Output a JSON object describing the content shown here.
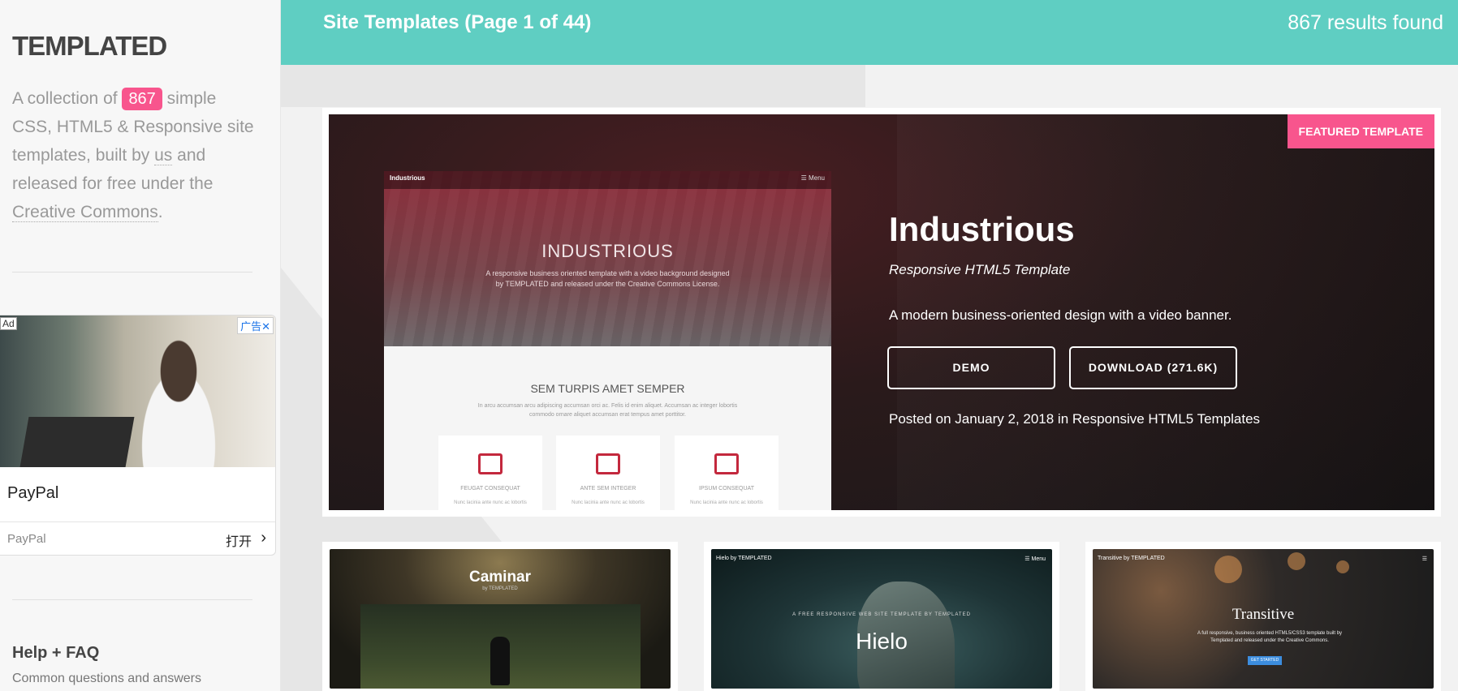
{
  "sidebar": {
    "logo": "TEMPLATED",
    "intro_prefix": "A collection of",
    "count": "867",
    "intro_mid": "simple CSS, HTML5 & Responsive site templates, built by",
    "us_link": "us",
    "intro_mid2": "and released for free under the",
    "cc_link": "Creative Commons",
    "intro_end": ".",
    "ad": {
      "tag": "Ad",
      "close_label": "广告✕",
      "title": "PayPal",
      "source": "PayPal",
      "open_label": "打开",
      "chevron": "›"
    },
    "help_title": "Help + FAQ",
    "help_sub": "Common questions and answers"
  },
  "header": {
    "title": "Site Templates (Page 1 of 44)",
    "results": "867 results found"
  },
  "featured": {
    "ribbon": "FEATURED TEMPLATE",
    "title": "Industrious",
    "subtitle": "Responsive HTML5 Template",
    "description": "A modern business-oriented design with a video banner.",
    "demo_label": "DEMO",
    "download_label": "DOWNLOAD (271.6K)",
    "posted": "Posted on January 2, 2018 in Responsive HTML5 Templates",
    "preview": {
      "brand": "Industrious",
      "menu": "☰ Menu",
      "hero_title": "INDUSTRIOUS",
      "hero_text": "A responsive business oriented template with a video background designed by TEMPLATED and released under the Creative Commons License.",
      "section_title": "SEM TURPIS AMET SEMPER",
      "section_text": "In arcu accumsan arcu adipiscing accumsan orci ac. Felis id enim aliquet. Accumsan ac integer lobortis commodo ornare aliquet accumsan erat tempus amet porttitor.",
      "cards": [
        {
          "title": "FEUGAT CONSEQUAT",
          "text": "Nunc lacinia ante nunc ac lobortis"
        },
        {
          "title": "ANTE SEM INTEGER",
          "text": "Nunc lacinia ante nunc ac lobortis"
        },
        {
          "title": "IPSUM CONSEQUAT",
          "text": "Nunc lacinia ante nunc ac lobortis"
        }
      ]
    }
  },
  "thumbnails": [
    {
      "name": "Caminar",
      "by": "by TEMPLATED"
    },
    {
      "name": "Hielo",
      "kicker": "A FREE RESPONSIVE WEB SITE TEMPLATE BY TEMPLATED",
      "nav": "Hielo by TEMPLATED",
      "menu": "☰ Menu"
    },
    {
      "name": "Transitive",
      "desc": "A full responsive, business oriented HTML5/CSS3 template built by Templated and released under the Creative Commons.",
      "cta": "GET STARTED",
      "nav": "Transitive by TEMPLATED",
      "menu": "☰"
    }
  ],
  "colors": {
    "accent": "#5fcec2",
    "badge": "#f8558d"
  }
}
